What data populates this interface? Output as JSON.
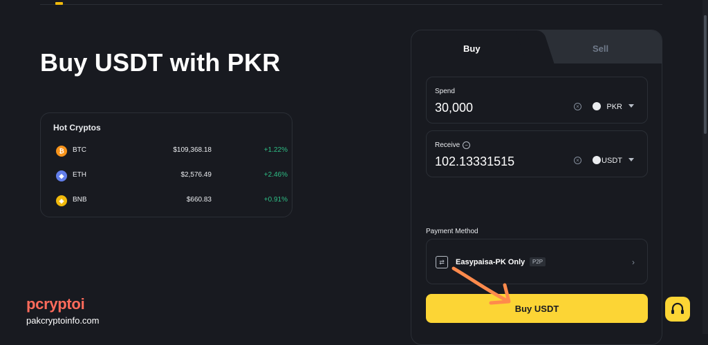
{
  "page": {
    "title": "Buy USDT with PKR"
  },
  "hot_cryptos": {
    "title": "Hot Cryptos",
    "coins": [
      {
        "symbol": "BTC",
        "price": "$109,368.18",
        "change": "+1.22%",
        "icon": "bitcoin-icon",
        "color": "#f7931a",
        "glyph": "₿"
      },
      {
        "symbol": "ETH",
        "price": "$2,576.49",
        "change": "+2.46%",
        "icon": "ethereum-icon",
        "color": "#627eea",
        "glyph": "◆"
      },
      {
        "symbol": "BNB",
        "price": "$660.83",
        "change": "+0.91%",
        "icon": "bnb-icon",
        "color": "#f0b90b",
        "glyph": "◈"
      }
    ]
  },
  "trade": {
    "tabs": {
      "buy": "Buy",
      "sell": "Sell"
    },
    "spend": {
      "label": "Spend",
      "value": "30,000",
      "currency": "PKR"
    },
    "receive": {
      "label": "Receive",
      "value": "102.13331515",
      "currency": "USDT"
    },
    "payment": {
      "label": "Payment Method",
      "name": "Easypaisa-PK Only",
      "badge": "P2P"
    },
    "buy_button": "Buy USDT"
  },
  "watermark": {
    "logo": "pcryptoi",
    "url": "pakcryptoinfo.com"
  },
  "colors": {
    "accent": "#fcd535",
    "positive": "#2ebd85",
    "background": "#181a20",
    "annotation": "#ff8a4c"
  }
}
